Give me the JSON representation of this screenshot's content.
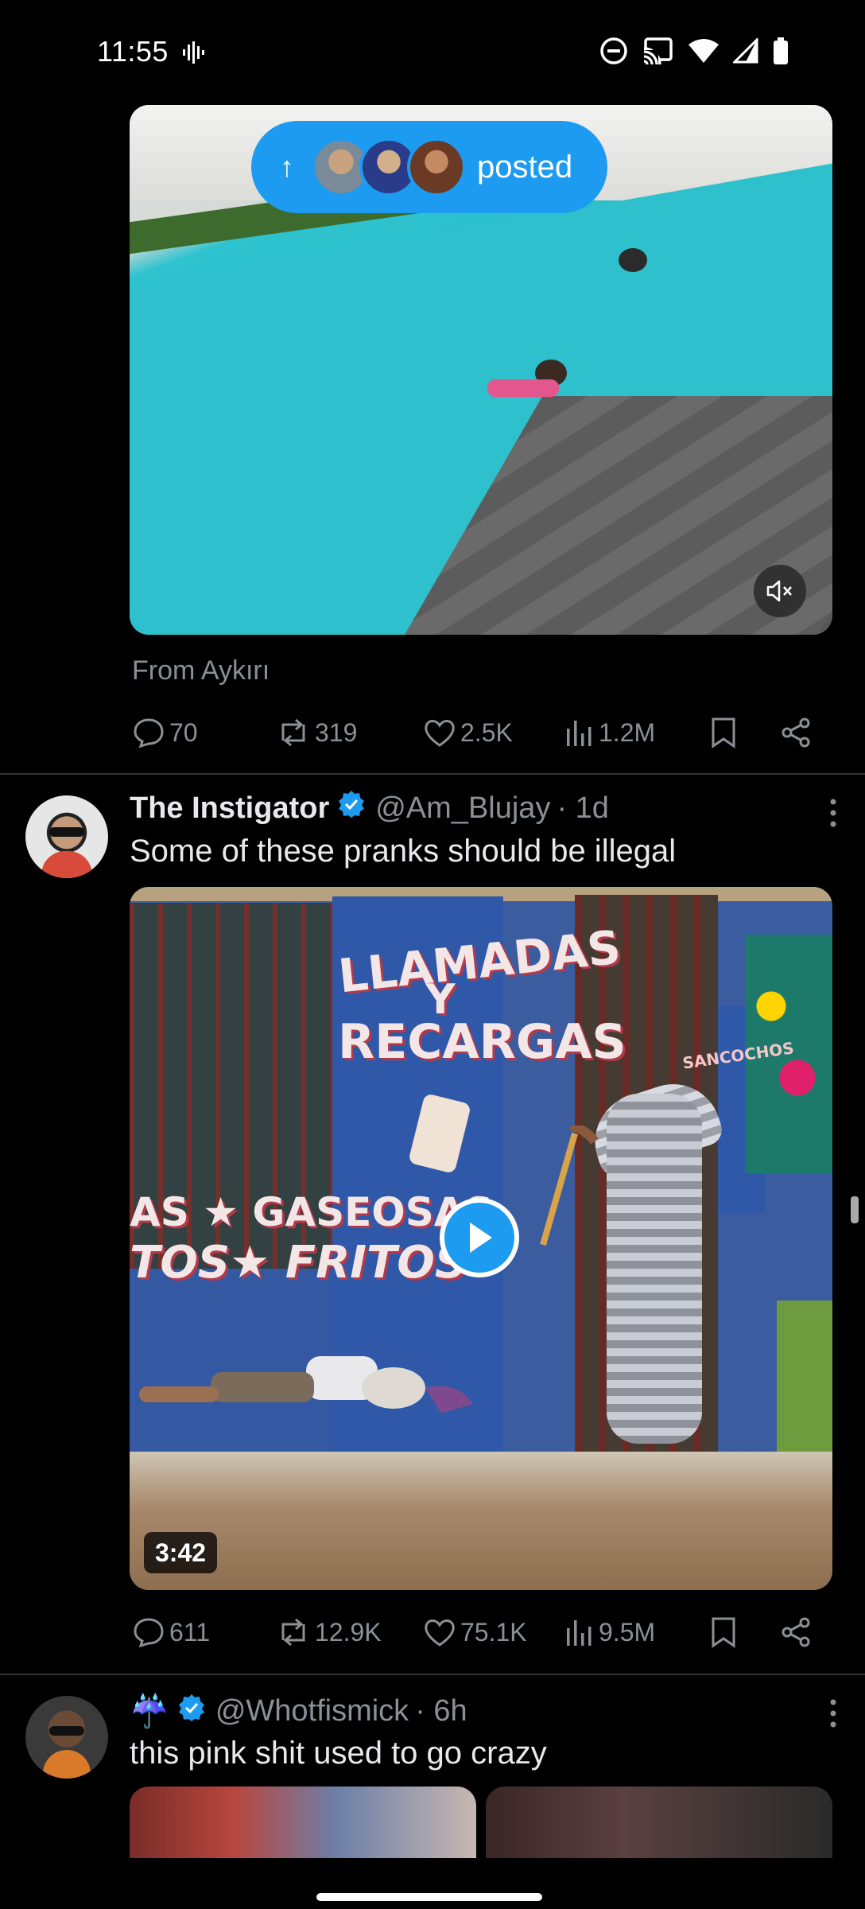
{
  "status_bar": {
    "time": "11:55",
    "icons": [
      "voicemail-icon",
      "do-not-disturb-icon",
      "cast-icon",
      "wifi-icon",
      "signal-icon",
      "battery-icon"
    ]
  },
  "first_post": {
    "posted_pill_label": "posted",
    "from_text": "From Aykırı",
    "actions": {
      "replies": "70",
      "reposts": "319",
      "likes": "2.5K",
      "views": "1.2M"
    }
  },
  "second_post": {
    "name": "The Instigator",
    "handle": "@Am_Blujay",
    "time": "· 1d",
    "text": "Some of these pranks should be illegal",
    "video_duration": "3:42",
    "video_sign_text": {
      "line1": "LLAMADAS",
      "line2": "Y",
      "line3": "RECARGAS",
      "line4": "AS ★ GASEOSAS",
      "line5": "TOS★ FRITOS",
      "side": "SANCOCHOS"
    },
    "actions": {
      "replies": "611",
      "reposts": "12.9K",
      "likes": "75.1K",
      "views": "9.5M"
    }
  },
  "third_post": {
    "name_emoji": "☔",
    "handle": "@Whotfismick",
    "time": "· 6h",
    "text": "this pink shit used to go crazy"
  },
  "colors": {
    "background": "#000000",
    "accent": "#1d9bf0",
    "muted_text": "#8b9097",
    "divider": "#2f3336"
  }
}
